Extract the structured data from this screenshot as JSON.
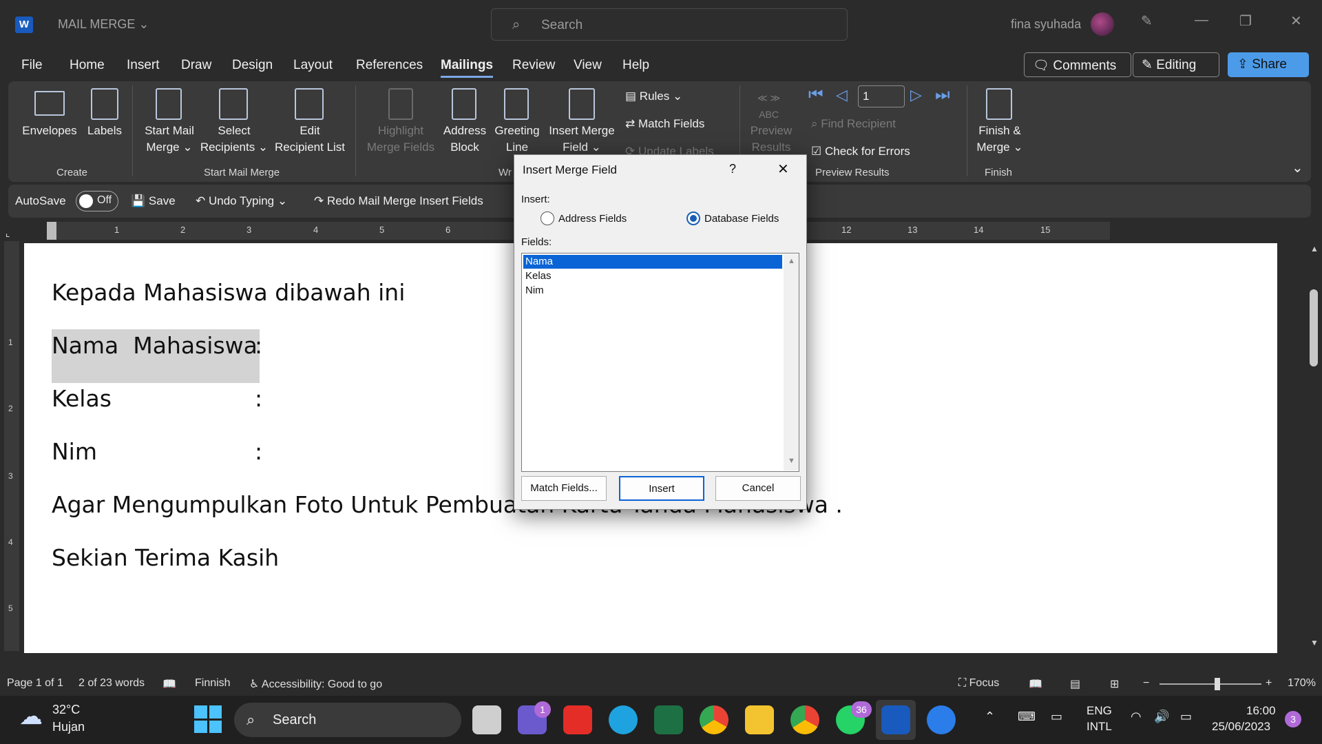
{
  "app": {
    "title": "MAIL MERGE",
    "search_placeholder": "Search",
    "user": "fina syuhada",
    "logo": "W"
  },
  "menu": [
    "File",
    "Home",
    "Insert",
    "Draw",
    "Design",
    "Layout",
    "References",
    "Mailings",
    "Review",
    "View",
    "Help"
  ],
  "top_buttons": {
    "comments": "Comments",
    "editing": "Editing",
    "share": "Share"
  },
  "ribbon": {
    "envelopes": "Envelopes",
    "labels": "Labels",
    "start_mail_merge": [
      "Start Mail",
      "Merge ⌄"
    ],
    "select_recipients": [
      "Select",
      "Recipients ⌄"
    ],
    "edit_recipient_list": [
      "Edit",
      "Recipient List"
    ],
    "highlight_merge_fields": [
      "Highlight",
      "Merge Fields"
    ],
    "address_block": [
      "Address",
      "Block"
    ],
    "greeting_line": [
      "Greeting",
      "Line"
    ],
    "insert_merge_field": [
      "Insert Merge",
      "Field ⌄"
    ],
    "rules": "Rules ⌄",
    "match_fields": "Match Fields",
    "update_labels": "Update Labels",
    "preview_results": [
      "Preview",
      "Results"
    ],
    "abc": "ABC",
    "record_number": "1",
    "find_recipient": "Find Recipient",
    "check_for_errors": "Check for Errors",
    "finish_merge": [
      "Finish &",
      "Merge ⌄"
    ],
    "groups": {
      "create": "Create",
      "start_mail_merge": "Start Mail Merge",
      "write": "Wr",
      "preview_results": "Preview Results",
      "finish": "Finish"
    }
  },
  "qat": {
    "autosave": "AutoSave",
    "toggle": "Off",
    "save": "Save",
    "undo": "Undo Typing",
    "redo": "Redo Mail Merge Insert Fields"
  },
  "ruler": [
    "1",
    "2",
    "3",
    "4",
    "5",
    "6",
    "12",
    "13",
    "14",
    "15"
  ],
  "vruler": [
    "1",
    "2",
    "3",
    "4",
    "5"
  ],
  "document": {
    "lines": [
      "Kepada Mahasiswa dibawah ini",
      "Nama  Mahasiswa",
      "Kelas",
      "Nim",
      "Agar Mengumpulkan Foto Untuk Pembuatan Kartu Tanda Mahasiswa .",
      "Sekian Terima Kasih"
    ],
    "colon": ":"
  },
  "dialog": {
    "title": "Insert Merge Field",
    "help": "?",
    "close": "✕",
    "insert_label": "Insert:",
    "address_fields": "Address Fields",
    "database_fields": "Database Fields",
    "fields_label": "Fields:",
    "fields": [
      "Nama",
      "Kelas",
      "Nim"
    ],
    "selected_field": "Nama",
    "match_fields_btn": "Match Fields...",
    "insert_btn": "Insert",
    "cancel_btn": "Cancel"
  },
  "status": {
    "page": "Page 1 of 1",
    "words": "2 of 23 words",
    "lang": "Finnish",
    "accessibility": "Accessibility: Good to go",
    "focus": "Focus",
    "zoom": "170%"
  },
  "taskbar": {
    "weather_temp": "32°C",
    "weather_desc": "Hujan",
    "search": "Search",
    "teams_badge": "1",
    "whatsapp_badge": "36",
    "lang1": "ENG",
    "lang2": "INTL",
    "time": "16:00",
    "date": "25/06/2023",
    "notif": "3"
  }
}
